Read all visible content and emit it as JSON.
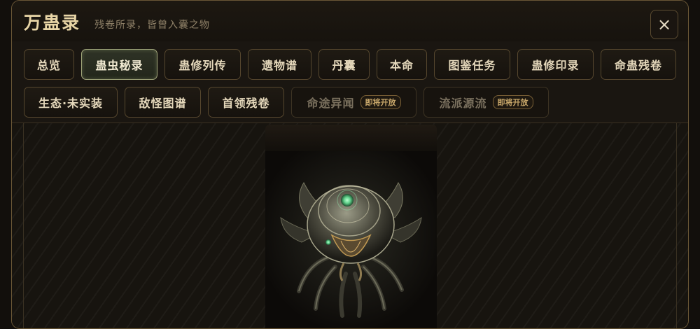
{
  "header": {
    "title": "万蛊录",
    "subtitle": "残卷所录，皆曾入囊之物",
    "close_label": "×"
  },
  "tabs": [
    {
      "label": "总览"
    },
    {
      "label": "蛊虫秘录",
      "active": true
    },
    {
      "label": "蛊修列传"
    },
    {
      "label": "遗物谱"
    },
    {
      "label": "丹囊"
    },
    {
      "label": "本命"
    },
    {
      "label": "图鉴任务"
    },
    {
      "label": "蛊修印录"
    },
    {
      "label": "命蛊残卷"
    },
    {
      "label": "生态·未实装"
    },
    {
      "label": "敌怪图谱"
    },
    {
      "label": "首领残卷"
    },
    {
      "label": "命途异闻",
      "disabled": true,
      "badge": "即将开放"
    },
    {
      "label": "流派源流",
      "disabled": true,
      "badge": "即将开放"
    }
  ],
  "card": {
    "icon": "gu-insect-art"
  },
  "colors": {
    "accent_gold": "#e9d6a7",
    "active_tab_border": "#a0a57a",
    "badge": "#c8a76a",
    "gem_green": "#5fd08a"
  }
}
